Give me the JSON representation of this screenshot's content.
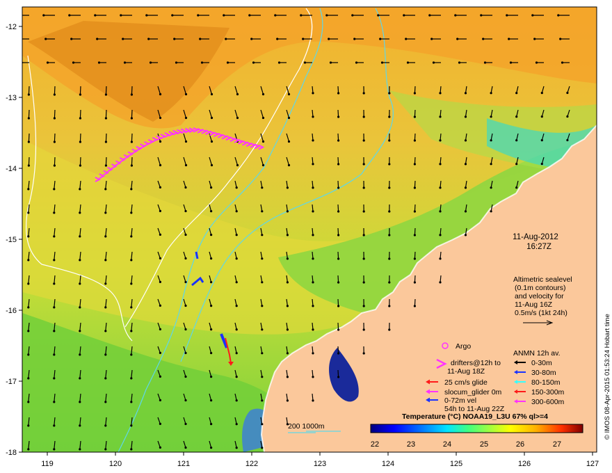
{
  "map": {
    "lon_ticks": [
      "119",
      "120",
      "121",
      "122",
      "123",
      "124",
      "125",
      "126",
      "127"
    ],
    "lat_ticks": [
      "-12",
      "-13",
      "-14",
      "-15",
      "-16",
      "-17",
      "-18"
    ],
    "date": "11-Aug-2012",
    "time": "16:27Z",
    "altimetry_lines": [
      "Altimetric sealevel",
      "(0.1m contours)",
      "and velocity for",
      "11-Aug 16Z",
      "0.5m/s (1kt 24h)"
    ],
    "argo_label": "Argo",
    "drifter_lines": [
      "drifters@12h to",
      "11-Aug 18Z"
    ],
    "glider_items": [
      {
        "label": "25 cm/s glide",
        "color": "#ff1a1a"
      },
      {
        "label": "slocum_glider 0m",
        "color": "#ff33ff"
      },
      {
        "label": "0-72m vel",
        "color": "#1a33ff"
      }
    ],
    "glider_extra": "54h to 11-Aug 22Z",
    "anmn_title": "ANMN 12h av.",
    "anmn_items": [
      {
        "label": "0-30m",
        "color": "#000000"
      },
      {
        "label": "30-80m",
        "color": "#1a33ff"
      },
      {
        "label": "80-150m",
        "color": "#33ffff"
      },
      {
        "label": "150-300m",
        "color": "#ff1a1a"
      },
      {
        "label": "300-600m",
        "color": "#ff33ff"
      }
    ],
    "isobath_label": "200  1000m",
    "colorbar_title": "Temperature (°C) NOAA19_L3U 67% ql>=4",
    "colorbar_ticks": [
      "22",
      "23",
      "24",
      "25",
      "26",
      "27"
    ],
    "credit": "© IMOS 08-Apr-2015 01:53:24 Hobart time",
    "colors": {
      "land": "#fbc89b",
      "warm": "#f5a62a",
      "mid": "#e8d43a",
      "cool": "#7ed63f",
      "cold": "#1a2a9a"
    }
  }
}
